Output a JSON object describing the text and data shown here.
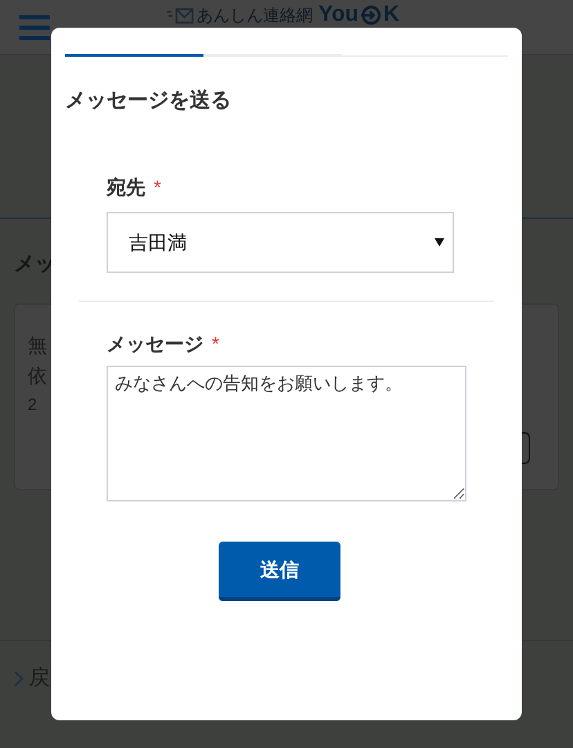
{
  "header": {
    "logo_tagline": "あんしん連絡網",
    "logo_word_start": "You",
    "logo_word_end": "K"
  },
  "background": {
    "section_title": "メッ",
    "card_lines": [
      "無",
      "依",
      "2"
    ],
    "back_link": "戻"
  },
  "modal": {
    "tabs": [
      {
        "selected": true
      },
      {
        "selected": false
      }
    ],
    "title": "メッセージを送る",
    "recipient": {
      "label": "宛先",
      "required_mark": "*",
      "value": "吉田満"
    },
    "message": {
      "label": "メッセージ",
      "required_mark": "*",
      "value": "みなさんへの告知をお願いします。"
    },
    "submit": "送信"
  }
}
